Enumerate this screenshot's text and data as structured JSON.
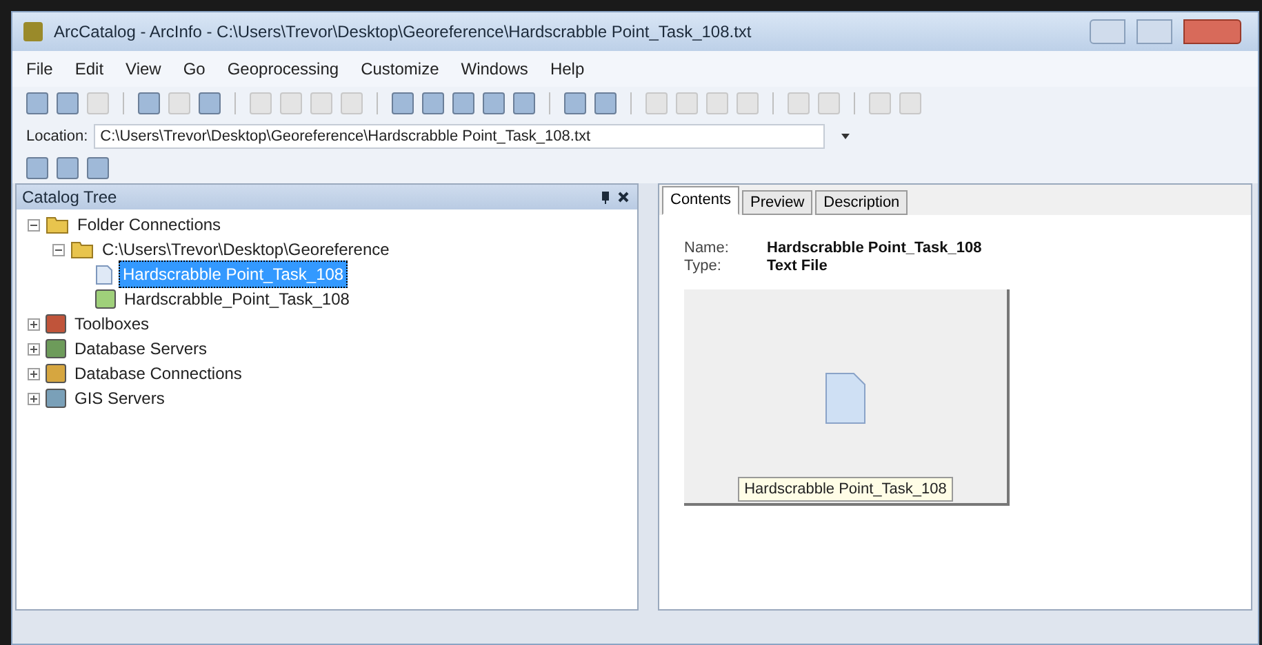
{
  "window": {
    "title": "ArcCatalog - ArcInfo - C:\\Users\\Trevor\\Desktop\\Georeference\\Hardscrabble Point_Task_108.txt"
  },
  "menu": [
    "File",
    "Edit",
    "View",
    "Go",
    "Geoprocessing",
    "Customize",
    "Windows",
    "Help"
  ],
  "location": {
    "label": "Location:",
    "value": "C:\\Users\\Trevor\\Desktop\\Georeference\\Hardscrabble Point_Task_108.txt"
  },
  "catalog_tree": {
    "title": "Catalog Tree",
    "items": [
      {
        "label": "Folder Connections",
        "kind": "folder",
        "expanded": true,
        "selected": false,
        "children": [
          {
            "label": "C:\\Users\\Trevor\\Desktop\\Georeference",
            "kind": "folder",
            "expanded": true,
            "selected": false,
            "children": [
              {
                "label": "Hardscrabble Point_Task_108",
                "kind": "text-file",
                "selected": true
              },
              {
                "label": "Hardscrabble_Point_Task_108",
                "kind": "shapefile",
                "selected": false
              }
            ]
          }
        ]
      },
      {
        "label": "Toolboxes",
        "kind": "toolbox",
        "expanded": false,
        "selected": false
      },
      {
        "label": "Database Servers",
        "kind": "database-server",
        "expanded": false,
        "selected": false
      },
      {
        "label": "Database Connections",
        "kind": "database-connection",
        "expanded": false,
        "selected": false
      },
      {
        "label": "GIS Servers",
        "kind": "gis-server",
        "expanded": false,
        "selected": false
      }
    ]
  },
  "tabs": [
    {
      "label": "Contents",
      "selected": true
    },
    {
      "label": "Preview",
      "selected": false
    },
    {
      "label": "Description",
      "selected": false
    }
  ],
  "contents": {
    "fields": [
      {
        "label": "Name:",
        "value": "Hardscrabble Point_Task_108"
      },
      {
        "label": "Type:",
        "value": "Text File"
      }
    ],
    "thumbnail_caption": "Hardscrabble Point_Task_108"
  }
}
